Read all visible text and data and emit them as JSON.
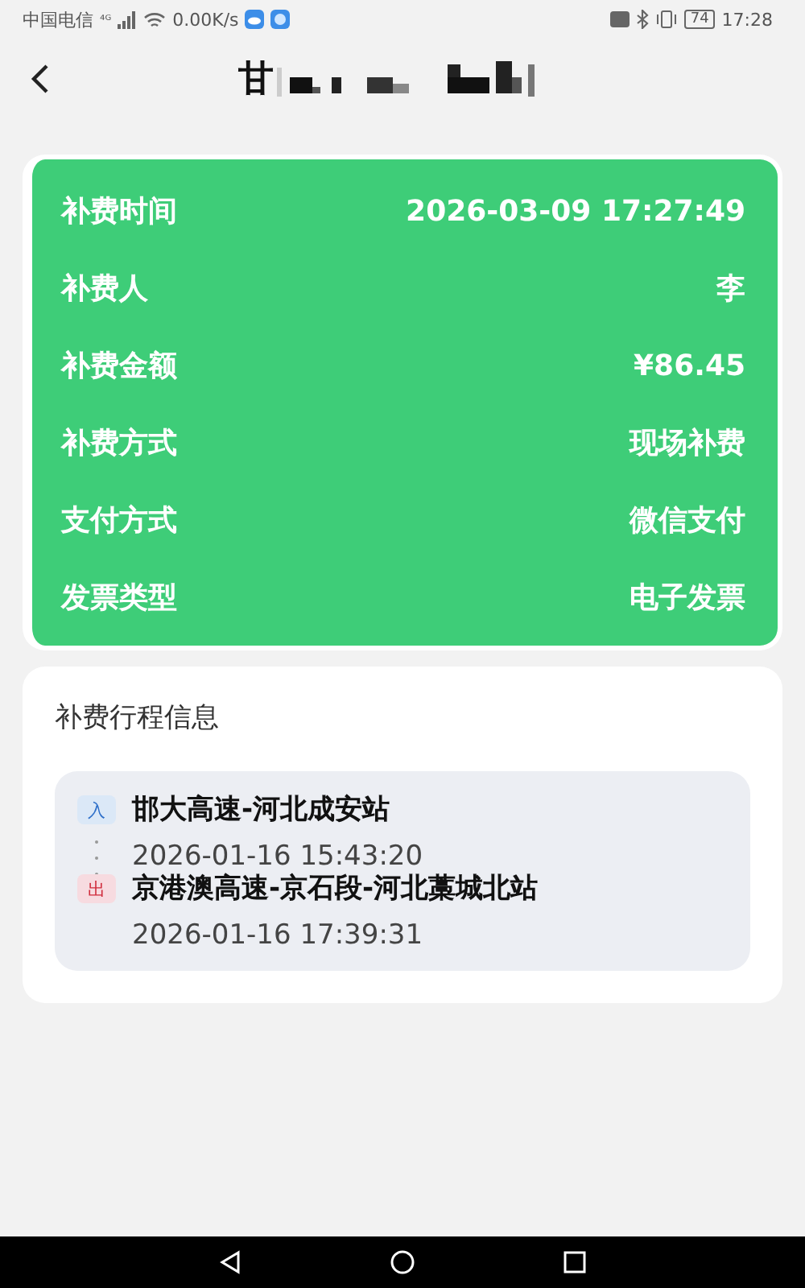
{
  "status_bar": {
    "carrier": "中国电信",
    "network_badge": "⁴ᴳ",
    "speed": "0.00K/s",
    "battery": "74",
    "time": "17:28"
  },
  "header": {
    "title": "甘"
  },
  "summary": {
    "rows": [
      {
        "label": "补费时间",
        "value": "2026-03-09 17:27:49"
      },
      {
        "label": "补费人",
        "value": "李"
      },
      {
        "label": "补费金额",
        "value": "¥86.45"
      },
      {
        "label": "补费方式",
        "value": "现场补费"
      },
      {
        "label": "支付方式",
        "value": "微信支付"
      },
      {
        "label": "发票类型",
        "value": "电子发票"
      }
    ]
  },
  "trip": {
    "title": "补费行程信息",
    "stops": [
      {
        "kind": "entry",
        "badge": "入",
        "station": "邯大高速-河北成安站",
        "time": "2026-01-16 15:43:20"
      },
      {
        "kind": "exit",
        "badge": "出",
        "station": "京港澳高速-京石段-河北藁城北站",
        "time": "2026-01-16 17:39:31"
      }
    ]
  }
}
